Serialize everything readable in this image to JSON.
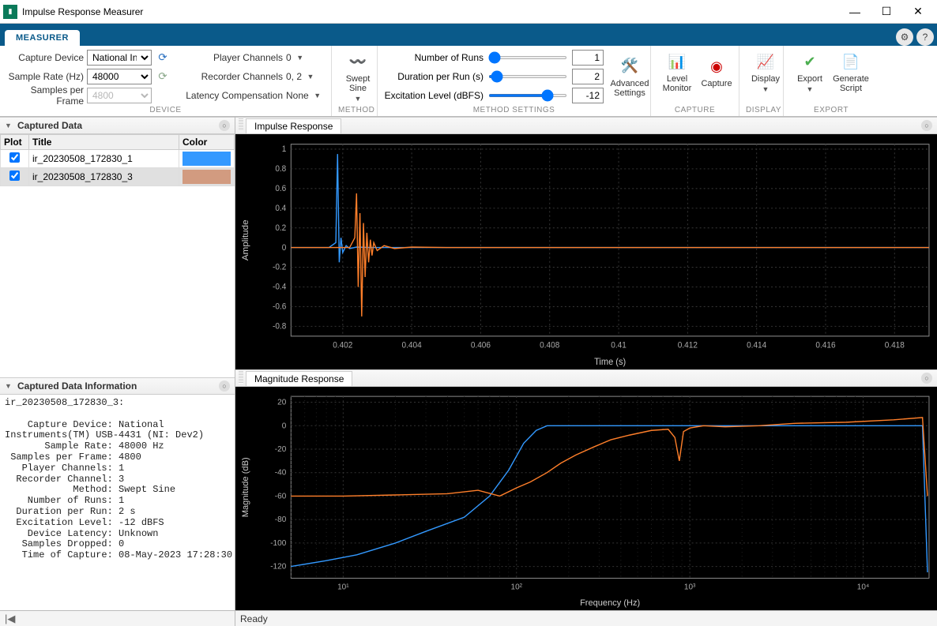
{
  "window": {
    "title": "Impulse Response Measurer"
  },
  "tabs": {
    "measurer": "MEASURER"
  },
  "ribbon": {
    "device": {
      "group_label": "DEVICE",
      "capture_device_label": "Capture Device",
      "capture_device_value": "National In...",
      "sample_rate_label": "Sample Rate (Hz)",
      "sample_rate_value": "48000",
      "samples_per_frame_label": "Samples per Frame",
      "samples_per_frame_value": "4800",
      "player_channels_label": "Player Channels",
      "player_channels_value": "0",
      "recorder_channels_label": "Recorder Channels",
      "recorder_channels_value": "0, 2",
      "latency_comp_label": "Latency Compensation",
      "latency_comp_value": "None"
    },
    "method": {
      "group_label": "METHOD",
      "swept_sine": "Swept\nSine"
    },
    "method_settings": {
      "group_label": "METHOD SETTINGS",
      "num_runs_label": "Number of Runs",
      "num_runs_value": "1",
      "duration_label": "Duration per Run (s)",
      "duration_value": "2",
      "excitation_label": "Excitation Level (dBFS)",
      "excitation_value": "-12",
      "advanced_settings": "Advanced\nSettings"
    },
    "capture": {
      "group_label": "CAPTURE",
      "level_monitor": "Level\nMonitor",
      "capture": "Capture"
    },
    "display": {
      "group_label": "DISPLAY",
      "display": "Display"
    },
    "export": {
      "group_label": "EXPORT",
      "export": "Export",
      "generate_script": "Generate\nScript"
    }
  },
  "captured_data": {
    "title": "Captured Data",
    "cols": {
      "plot": "Plot",
      "title": "Title",
      "color": "Color"
    },
    "rows": [
      {
        "checked": true,
        "title": "ir_20230508_172830_1",
        "color": "#3399ff"
      },
      {
        "checked": true,
        "title": "ir_20230508_172830_3",
        "color": "#d29b80"
      }
    ],
    "selected_index": 1
  },
  "captured_info": {
    "title": "Captured Data Information",
    "body": "ir_20230508_172830_3:\n\n    Capture Device: National\nInstruments(TM) USB-4431 (NI: Dev2)\n       Sample Rate: 48000 Hz\n Samples per Frame: 4800\n   Player Channels: 1\n  Recorder Channel: 3\n            Method: Swept Sine\n    Number of Runs: 1\n  Duration per Run: 2 s\n  Excitation Level: -12 dBFS\n    Device Latency: Unknown\n   Samples Dropped: 0\n   Time of Capture: 08-May-2023 17:28:30"
  },
  "plots": {
    "impulse_tab": "Impulse Response",
    "magnitude_tab": "Magnitude Response"
  },
  "status": {
    "ready": "Ready"
  },
  "chart_data": [
    {
      "id": "impulse",
      "type": "line",
      "title": "Impulse Response",
      "xlabel": "Time (s)",
      "ylabel": "Amplitude",
      "xlim": [
        0.4005,
        0.419
      ],
      "ylim": [
        -0.9,
        1.05
      ],
      "xticks": [
        0.402,
        0.404,
        0.406,
        0.408,
        0.41,
        0.412,
        0.414,
        0.416,
        0.418
      ],
      "yticks": [
        -0.8,
        -0.6,
        -0.4,
        -0.2,
        0,
        0.2,
        0.4,
        0.6,
        0.8,
        1
      ],
      "series": [
        {
          "name": "ir_20230508_172830_1",
          "color": "#3399ff",
          "x": [
            0.4005,
            0.4016,
            0.4018,
            0.40185,
            0.4019,
            0.40195,
            0.402,
            0.4021,
            0.4022,
            0.4024,
            0.4028,
            0.4035,
            0.405,
            0.419
          ],
          "y": [
            0,
            0,
            0.05,
            0.95,
            -0.15,
            0.1,
            -0.05,
            0.02,
            -0.01,
            0.005,
            0,
            0,
            0,
            0
          ]
        },
        {
          "name": "ir_20230508_172830_3",
          "color": "#ff7f2a",
          "x": [
            0.4005,
            0.4022,
            0.40235,
            0.4024,
            0.40245,
            0.4025,
            0.40255,
            0.4026,
            0.40265,
            0.4027,
            0.40275,
            0.4028,
            0.40285,
            0.4029,
            0.403,
            0.4032,
            0.4035,
            0.404,
            0.405,
            0.406,
            0.408,
            0.419
          ],
          "y": [
            0,
            0,
            0.1,
            0.55,
            -0.4,
            0.35,
            -0.7,
            0.25,
            -0.3,
            0.15,
            -0.15,
            0.08,
            -0.08,
            0.05,
            -0.03,
            0.02,
            -0.01,
            0.005,
            0,
            0,
            0,
            0
          ]
        }
      ]
    },
    {
      "id": "magnitude",
      "type": "line",
      "title": "Magnitude Response",
      "xlabel": "Frequency (Hz)",
      "ylabel": "Magnitude (dB)",
      "xscale": "log",
      "xlim": [
        5,
        24000
      ],
      "ylim": [
        -130,
        25
      ],
      "xticks": [
        10,
        100,
        1000,
        10000
      ],
      "xtick_labels": [
        "10¹",
        "10²",
        "10³",
        "10⁴"
      ],
      "yticks": [
        -120,
        -100,
        -80,
        -60,
        -40,
        -20,
        0,
        20
      ],
      "series": [
        {
          "name": "ir_20230508_172830_1",
          "color": "#3399ff",
          "x": [
            5,
            8,
            12,
            20,
            30,
            50,
            70,
            90,
            110,
            130,
            150,
            200,
            300,
            500,
            1000,
            3000,
            10000,
            22000,
            23500
          ],
          "y": [
            -120,
            -115,
            -110,
            -100,
            -90,
            -78,
            -60,
            -38,
            -15,
            -4,
            0,
            0,
            0,
            0,
            0,
            0,
            0,
            0,
            -125
          ]
        },
        {
          "name": "ir_20230508_172830_3",
          "color": "#ff7f2a",
          "x": [
            5,
            10,
            20,
            40,
            60,
            80,
            100,
            120,
            150,
            180,
            220,
            280,
            350,
            450,
            600,
            750,
            820,
            870,
            920,
            1000,
            1200,
            1600,
            2500,
            4000,
            8000,
            15000,
            22000,
            23500
          ],
          "y": [
            -60,
            -60,
            -59,
            -58,
            -55,
            -60,
            -53,
            -48,
            -40,
            -32,
            -25,
            -18,
            -12,
            -8,
            -4,
            -3,
            -10,
            -30,
            -5,
            -2,
            0,
            -1,
            0,
            2,
            3,
            5,
            7,
            -60
          ]
        }
      ]
    }
  ]
}
